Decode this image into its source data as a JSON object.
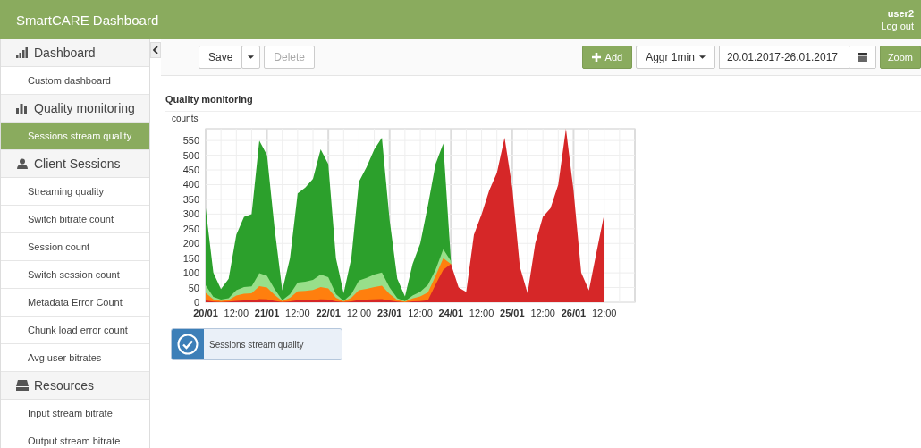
{
  "header": {
    "title": "SmartCARE Dashboard",
    "user": "user2",
    "logout": "Log out"
  },
  "sidebar": {
    "items": [
      {
        "kind": "section",
        "label": "Dashboard",
        "selected": false
      },
      {
        "kind": "item",
        "label": "Custom dashboard",
        "selected": false
      },
      {
        "kind": "section",
        "label": "Quality monitoring",
        "selected": false
      },
      {
        "kind": "item",
        "label": "Sessions stream quality",
        "selected": true
      },
      {
        "kind": "section",
        "label": "Client Sessions",
        "selected": false
      },
      {
        "kind": "item",
        "label": "Streaming quality",
        "selected": false
      },
      {
        "kind": "item",
        "label": "Switch bitrate count",
        "selected": false
      },
      {
        "kind": "item",
        "label": "Session count",
        "selected": false
      },
      {
        "kind": "item",
        "label": "Switch session count",
        "selected": false
      },
      {
        "kind": "item",
        "label": "Metadata Error Count",
        "selected": false
      },
      {
        "kind": "item",
        "label": "Chunk load error count",
        "selected": false
      },
      {
        "kind": "item",
        "label": "Avg user bitrates",
        "selected": false
      },
      {
        "kind": "section",
        "label": "Resources",
        "selected": false
      },
      {
        "kind": "item",
        "label": "Input stream bitrate",
        "selected": false
      },
      {
        "kind": "item",
        "label": "Output stream bitrate",
        "selected": false
      }
    ]
  },
  "toolbar": {
    "save": "Save",
    "delete": {
      "label": "Delete",
      "disabled": true
    },
    "add": "Add",
    "aggregation": "Aggr 1min",
    "date_range": "20.01.2017-26.01.2017",
    "zoom": "Zoom"
  },
  "panel": {
    "title": "Quality monitoring",
    "chart_data": {
      "type": "area",
      "ylabel": "counts",
      "stacked": false,
      "grid": true,
      "ylim": [
        0,
        590
      ],
      "categories": [
        "20/01",
        null,
        null,
        null,
        "12:00",
        null,
        null,
        null,
        "21/01",
        null,
        null,
        null,
        "12:00",
        null,
        null,
        null,
        "22/01",
        null,
        null,
        null,
        "12:00",
        null,
        null,
        null,
        "23/01",
        null,
        null,
        null,
        "12:00",
        null,
        null,
        null,
        "24/01",
        null,
        null,
        null,
        "12:00",
        null,
        null,
        null,
        "25/01",
        null,
        null,
        null,
        "12:00",
        null,
        null,
        null,
        "26/01",
        null,
        null,
        null,
        "12:00",
        null,
        null,
        null,
        null
      ],
      "series": [
        {
          "color": "#d62728",
          "values": [
            6,
            2,
            1,
            2,
            5,
            6,
            6,
            11,
            10,
            5,
            1,
            3,
            7,
            8,
            8,
            10,
            9,
            3,
            1,
            3,
            8,
            9,
            10,
            11,
            6,
            2,
            0,
            3,
            4,
            7,
            60,
            110,
            130,
            50,
            35,
            230,
            300,
            380,
            440,
            560,
            390,
            120,
            30,
            200,
            290,
            320,
            400,
            590,
            380,
            100,
            40,
            170,
            300,
            null,
            null,
            null,
            null
          ]
        },
        {
          "color": "#ff7f0e",
          "values": [
            32,
            10,
            5,
            8,
            23,
            29,
            30,
            55,
            50,
            25,
            4,
            15,
            37,
            39,
            42,
            52,
            47,
            15,
            3,
            15,
            41,
            46,
            52,
            56,
            28,
            8,
            2,
            13,
            20,
            33,
            90,
            150,
            130,
            null,
            null,
            null,
            null,
            null,
            null,
            null,
            null,
            null,
            null,
            null,
            null,
            null,
            null,
            null,
            null,
            null,
            null,
            null,
            null,
            null,
            null,
            null,
            null
          ]
        },
        {
          "color": "#98df8a",
          "values": [
            58,
            18,
            9,
            14,
            41,
            52,
            54,
            99,
            90,
            45,
            7,
            27,
            67,
            70,
            76,
            94,
            85,
            27,
            5,
            27,
            74,
            83,
            94,
            101,
            50,
            14,
            4,
            23,
            36,
            59,
            110,
            180,
            140,
            null,
            null,
            null,
            null,
            null,
            null,
            null,
            null,
            null,
            null,
            null,
            null,
            null,
            null,
            null,
            null,
            null,
            null,
            null,
            null,
            null,
            null,
            null,
            null
          ]
        },
        {
          "color": "#2ca02c",
          "values": [
            320,
            100,
            45,
            80,
            230,
            290,
            300,
            550,
            500,
            250,
            40,
            150,
            370,
            390,
            420,
            520,
            470,
            150,
            30,
            150,
            410,
            460,
            520,
            560,
            280,
            80,
            20,
            130,
            200,
            330,
            470,
            540,
            140,
            null,
            null,
            null,
            null,
            null,
            null,
            null,
            null,
            null,
            null,
            null,
            null,
            null,
            null,
            null,
            null,
            null,
            null,
            null,
            null,
            null,
            null,
            null,
            null
          ]
        }
      ],
      "yticks": [
        0,
        50,
        100,
        150,
        200,
        250,
        300,
        350,
        400,
        450,
        500,
        550
      ]
    },
    "legend": [
      {
        "label": "Sessions stream quality",
        "checked": true
      }
    ]
  }
}
